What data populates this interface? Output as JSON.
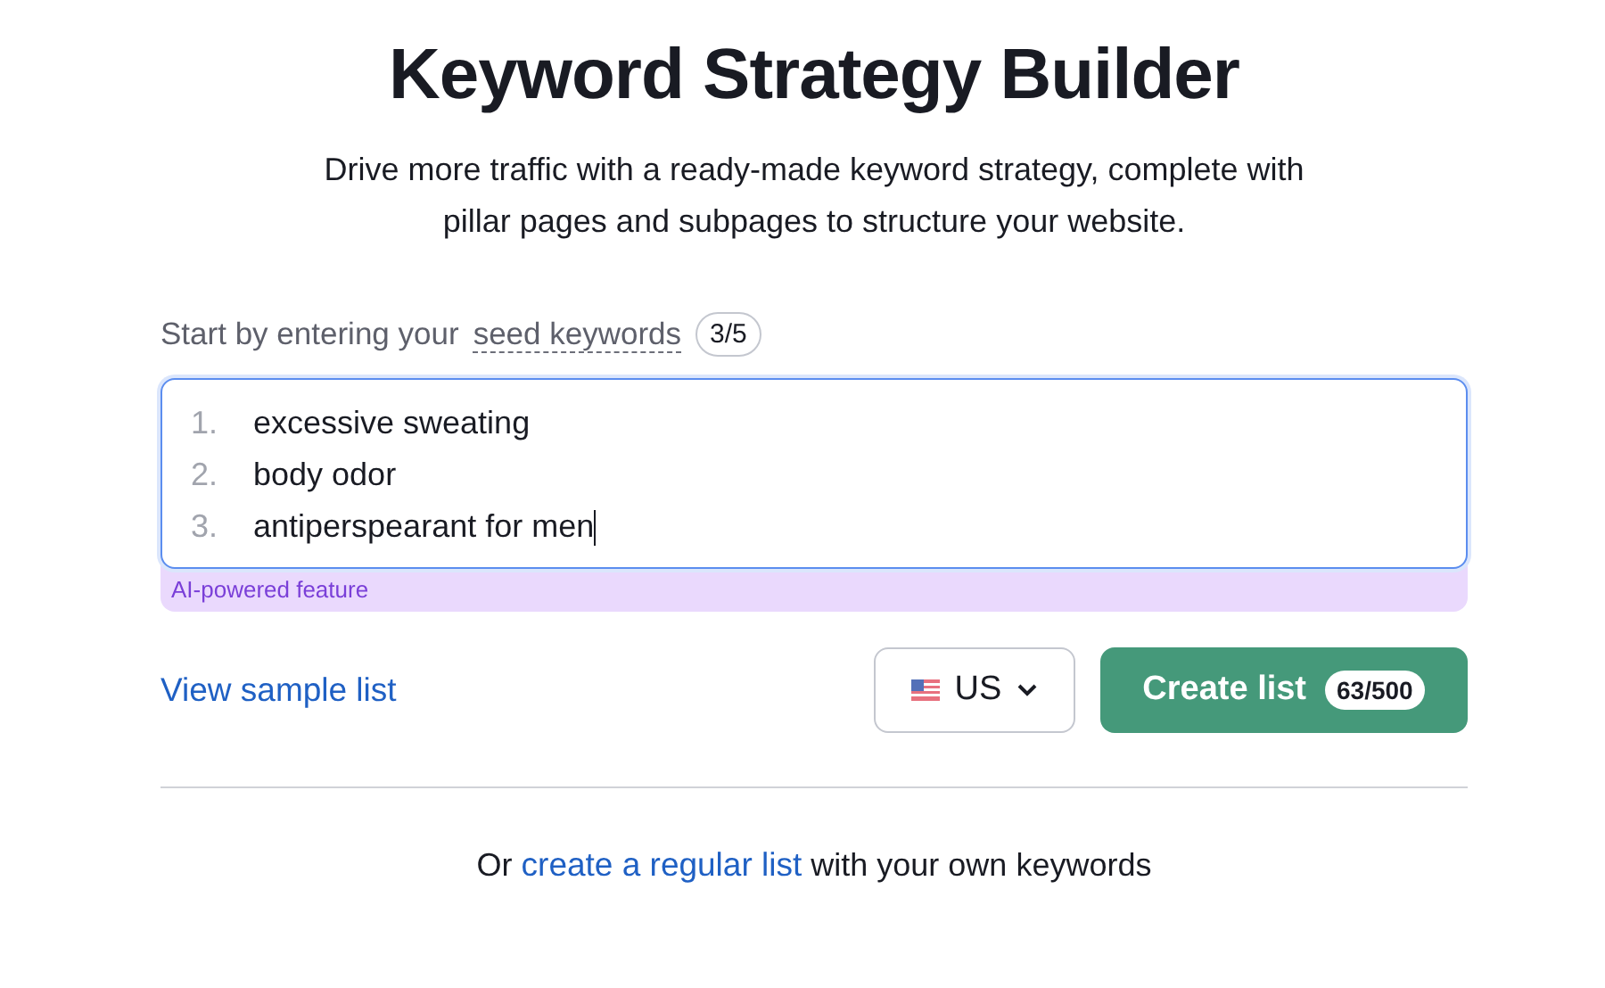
{
  "title": "Keyword Strategy Builder",
  "subtitle": "Drive more traffic with a ready-made keyword strategy, complete with pillar pages and subpages to structure your website.",
  "seed": {
    "prefix": "Start by entering your",
    "term": "seed keywords",
    "count": "3/5"
  },
  "keywords": [
    {
      "number": "1.",
      "text": "excessive sweating",
      "focused": false
    },
    {
      "number": "2.",
      "text": "body odor",
      "focused": false
    },
    {
      "number": "3.",
      "text": "antiperspearant for men",
      "focused": true
    }
  ],
  "ai_note": "AI-powered feature",
  "sample_link": "View sample list",
  "country": {
    "code": "US"
  },
  "create_button": {
    "label": "Create list",
    "quota": "63/500"
  },
  "footer": {
    "prefix": "Or",
    "link": "create a regular list",
    "suffix": "with your own keywords"
  }
}
